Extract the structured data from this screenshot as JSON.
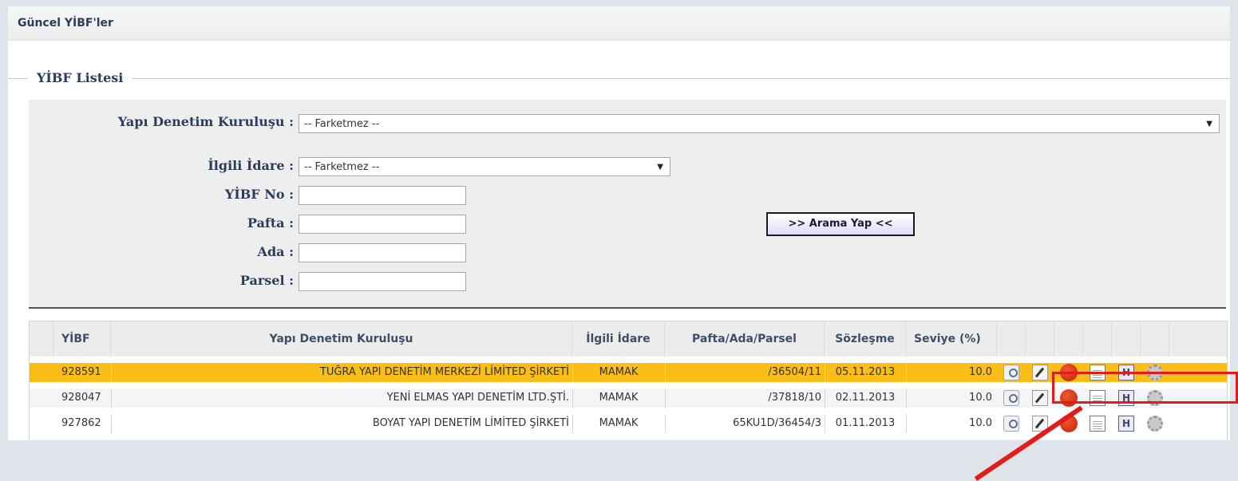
{
  "header": {
    "title": "Güncel YİBF'ler"
  },
  "legend": {
    "title": "YİBF Listesi"
  },
  "filters": {
    "ydk_label": "Yapı Denetim Kuruluşu :",
    "ydk_value": "-- Farketmez --",
    "idare_label": "İlgili İdare :",
    "idare_value": "-- Farketmez --",
    "yibf_label": "YİBF No :",
    "pafta_label": "Pafta :",
    "ada_label": "Ada :",
    "parsel_label": "Parsel :",
    "search_button": ">> Arama Yap <<"
  },
  "table": {
    "headers": {
      "yibf": "YİBF",
      "kurulus": "Yapı Denetim Kuruluşu",
      "idare": "İlgili İdare",
      "pafta": "Pafta/Ada/Parsel",
      "sozlesme": "Sözleşme",
      "seviye": "Seviye (%)"
    },
    "rows": [
      {
        "yibf": "928591",
        "kurulus": "TUĞRA YAPI DENETİM MERKEZİ LİMİTED ŞİRKETİ",
        "idare": "MAMAK",
        "pafta": "/36504/11",
        "sozlesme": "05.11.2013",
        "seviye": "10.0"
      },
      {
        "yibf": "928047",
        "kurulus": "YENİ ELMAS YAPI DENETİM LTD.ŞTİ.",
        "idare": "MAMAK",
        "pafta": "/37818/10",
        "sozlesme": "02.11.2013",
        "seviye": "10.0"
      },
      {
        "yibf": "927862",
        "kurulus": "BOYAT YAPI DENETİM LİMİTED ŞİRKETİ",
        "idare": "MAMAK",
        "pafta": "65KU1D/36454/3",
        "sozlesme": "01.11.2013",
        "seviye": "10.0"
      }
    ],
    "row_action_icons": [
      "magnifier-icon",
      "edit-pen-icon",
      "red-circle-icon",
      "notepad-icon",
      "h-icon",
      "gear-icon"
    ]
  },
  "colors": {
    "selected_row": "#fbbd17",
    "annotation": "#e21b1b",
    "title_text": "#2b3c5c"
  }
}
